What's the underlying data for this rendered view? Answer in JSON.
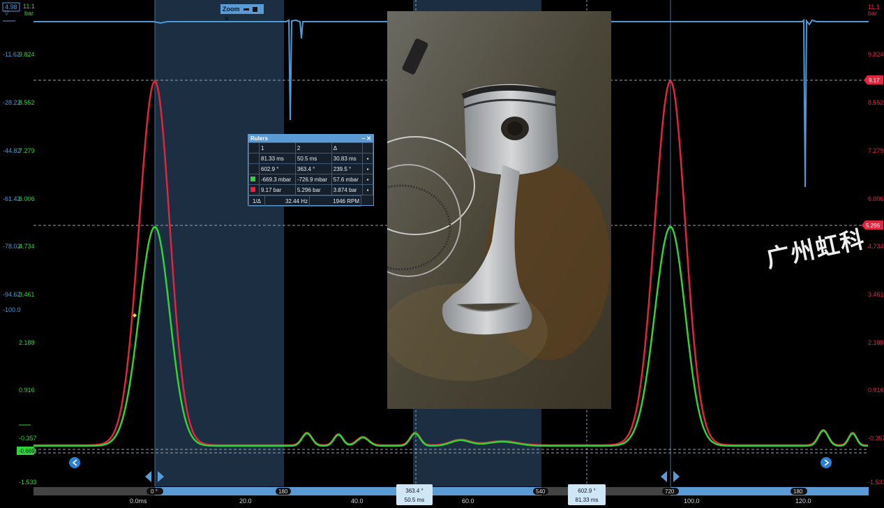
{
  "colors": {
    "pressure_blue": "#4f9ad8",
    "red_trace": "#e0263f",
    "green_trace": "#32d336",
    "axis_green": "#31d33a",
    "axis_red": "#e0263f",
    "shade": "#1c2e42",
    "timeline": "#5b9bd5"
  },
  "zoom": {
    "label": "Zoom"
  },
  "left_axis": {
    "top_value": "4.98",
    "top_unit_value": "11.1",
    "top_unit": "bar",
    "pairs": [
      {
        "blue": "-11.62",
        "green": "9.824"
      },
      {
        "blue": "-28.22",
        "green": "8.552"
      },
      {
        "blue": "-44.82",
        "green": "7.279"
      },
      {
        "blue": "-61.42",
        "green": "6.006"
      },
      {
        "blue": "-78.02",
        "green": "4.734"
      },
      {
        "blue": "-94.62",
        "green": "3.461"
      }
    ],
    "blue_extra": "-100.0",
    "green_only": [
      "2.188",
      "0.916",
      "-0.357",
      "-1.533"
    ],
    "cursor_badge": "-0.669"
  },
  "right_axis": {
    "top_value": "11.1",
    "top_unit": "bar",
    "values": [
      "9.824",
      "8.552",
      "7.279",
      "6.006",
      "4.734",
      "3.461",
      "2.188",
      "0.916",
      "-0.357",
      "-1.533"
    ],
    "badge_high": "9.17",
    "badge_mid": "5.296"
  },
  "rulers": {
    "title": "Rulers",
    "controls": "– ✕",
    "headers": [
      "1",
      "2",
      "Δ"
    ],
    "rows": [
      {
        "swatch": "",
        "c1": "81.33 ms",
        "c2": "50.5 ms",
        "c3": "30.83 ms"
      },
      {
        "swatch": "",
        "c1": "602.9 °",
        "c2": "363.4 °",
        "c3": "239.5 °"
      },
      {
        "swatch": "#32d336",
        "c1": "-669.3 mbar",
        "c2": "-726.9 mbar",
        "c3": "57.6 mbar"
      },
      {
        "swatch": "#e0263f",
        "c1": "9.17 bar",
        "c2": "5.296 bar",
        "c3": "3.874 bar"
      }
    ],
    "freq_label": "1/Δ",
    "freq": "32.44 Hz",
    "rpm": "1946 RPM"
  },
  "timeline": {
    "degree_marks": [
      "0 °",
      "180",
      "363.4 °",
      "540",
      "602.9 °",
      "720",
      "180"
    ],
    "cursor1_ms": "50.5 ms",
    "cursor2_ms": "81.33 ms",
    "time_ticks": [
      "0.0ms",
      "20.0",
      "40.0",
      "60.0",
      "100.0",
      "120.0"
    ]
  },
  "photo": {
    "subject": "piston-connecting-rod-photo"
  },
  "watermark": "广州虹科"
}
